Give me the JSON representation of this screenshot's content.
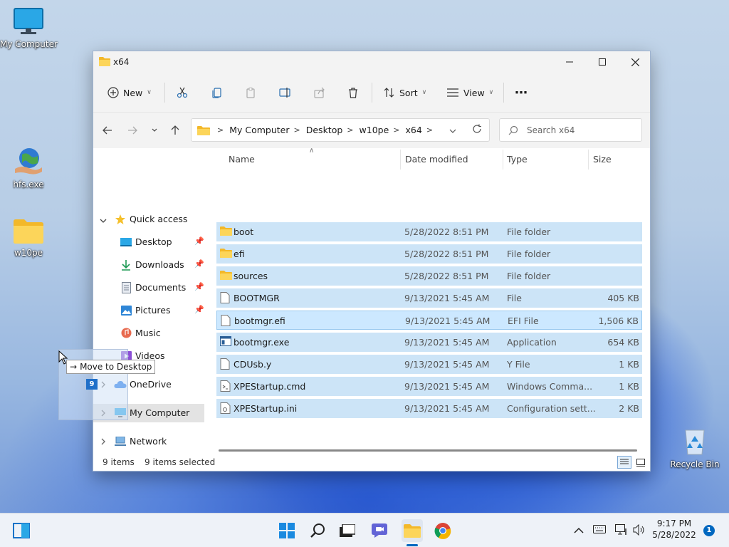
{
  "desktop": {
    "icons": [
      {
        "label": "My Computer"
      },
      {
        "label": "hfs.exe"
      },
      {
        "label": "w10pe"
      },
      {
        "label": "Recycle Bin"
      }
    ]
  },
  "window": {
    "title": "x64",
    "toolbar": {
      "new": "New",
      "sort": "Sort",
      "view": "View"
    },
    "breadcrumbs": [
      "My Computer",
      "Desktop",
      "w10pe",
      "x64"
    ],
    "search_placeholder": "Search x64",
    "sidebar": {
      "quick_access": "Quick access",
      "items": [
        "Desktop",
        "Downloads",
        "Documents",
        "Pictures",
        "Music",
        "Videos"
      ],
      "onedrive": "OneDrive",
      "my_computer": "My Computer",
      "network": "Network"
    },
    "columns": [
      "Name",
      "Date modified",
      "Type",
      "Size"
    ],
    "files": [
      {
        "name": "boot",
        "date": "5/28/2022 8:51 PM",
        "type": "File folder",
        "size": ""
      },
      {
        "name": "efi",
        "date": "5/28/2022 8:51 PM",
        "type": "File folder",
        "size": ""
      },
      {
        "name": "sources",
        "date": "5/28/2022 8:51 PM",
        "type": "File folder",
        "size": ""
      },
      {
        "name": "BOOTMGR",
        "date": "9/13/2021 5:45 AM",
        "type": "File",
        "size": "405 KB"
      },
      {
        "name": "bootmgr.efi",
        "date": "9/13/2021 5:45 AM",
        "type": "EFI File",
        "size": "1,506 KB"
      },
      {
        "name": "bootmgr.exe",
        "date": "9/13/2021 5:45 AM",
        "type": "Application",
        "size": "654 KB"
      },
      {
        "name": "CDUsb.y",
        "date": "9/13/2021 5:45 AM",
        "type": "Y File",
        "size": "1 KB"
      },
      {
        "name": "XPEStartup.cmd",
        "date": "9/13/2021 5:45 AM",
        "type": "Windows Comma...",
        "size": "1 KB"
      },
      {
        "name": "XPEStartup.ini",
        "date": "9/13/2021 5:45 AM",
        "type": "Configuration sett...",
        "size": "2 KB"
      }
    ],
    "status": {
      "count": "9 items",
      "selected": "9 items selected"
    }
  },
  "drag": {
    "tooltip": "Move to Desktop",
    "count": "9"
  },
  "taskbar": {
    "time": "9:17 PM",
    "date": "5/28/2022",
    "notifications": "1"
  },
  "colors": {
    "selection": "#cce4f7",
    "accent": "#0067c0",
    "folder": "#f8c83b"
  }
}
